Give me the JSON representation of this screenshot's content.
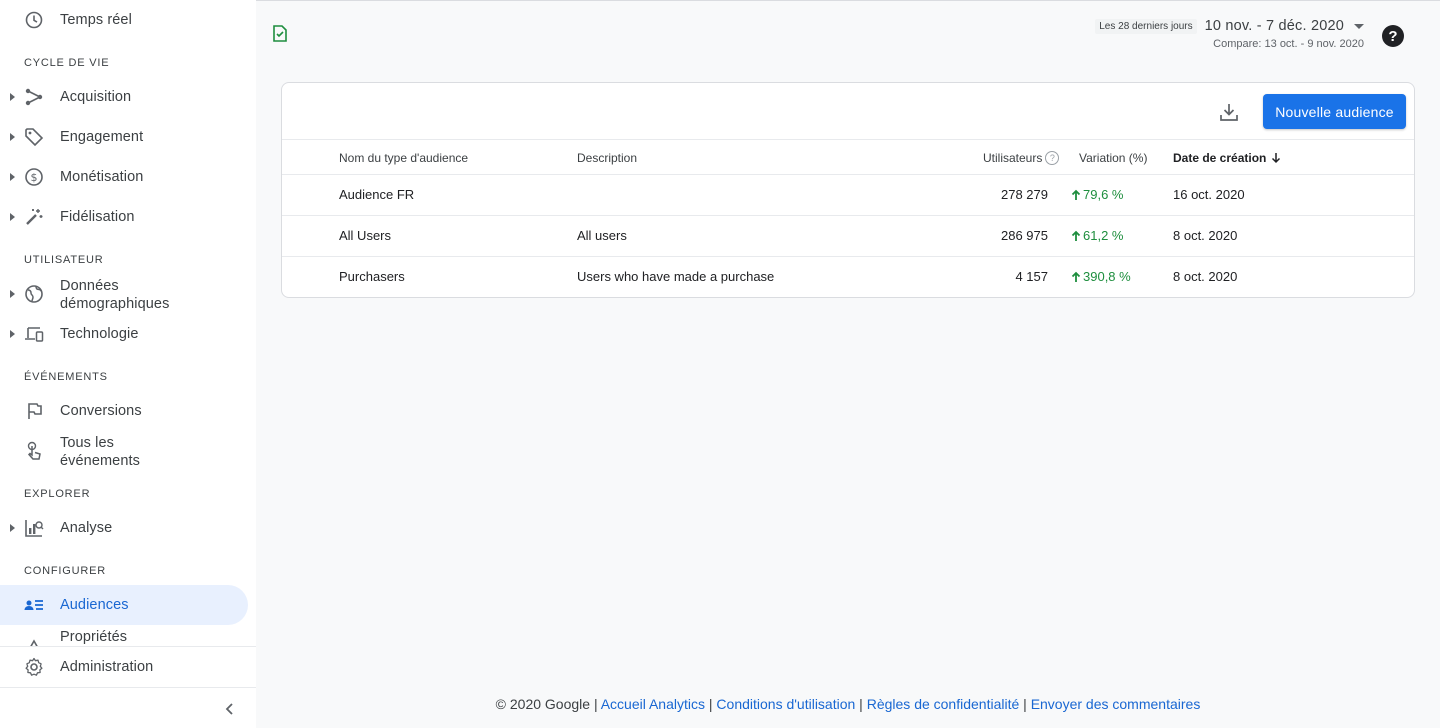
{
  "sidebar": {
    "realtime_label": "Temps réel",
    "sections": {
      "lifecycle": "CYCLE DE VIE",
      "user": "UTILISATEUR",
      "events": "ÉVÉNEMENTS",
      "explore": "EXPLORER",
      "configure": "CONFIGURER"
    },
    "items": {
      "acquisition": "Acquisition",
      "engagement": "Engagement",
      "monetization": "Monétisation",
      "retention": "Fidélisation",
      "demographics_1": "Données",
      "demographics_2": "démographiques",
      "technology": "Technologie",
      "conversions": "Conversions",
      "all_events_1": "Tous les",
      "all_events_2": "événements",
      "analysis": "Analyse",
      "audiences": "Audiences",
      "properties": "Propriétés",
      "admin": "Administration"
    }
  },
  "header": {
    "date_chip": "Les 28 derniers jours",
    "date_range": "10 nov. - 7 déc. 2020",
    "compare": "Compare: 13 oct. - 9 nov. 2020"
  },
  "toolbar": {
    "new_audience": "Nouvelle audience"
  },
  "table": {
    "columns": {
      "name": "Nom du type d'audience",
      "description": "Description",
      "users": "Utilisateurs",
      "variation": "Variation (%)",
      "created": "Date de création"
    },
    "rows": [
      {
        "name": "Audience FR",
        "description": "",
        "users": "278 279",
        "variation": "79,6 %",
        "created": "16 oct. 2020"
      },
      {
        "name": "All Users",
        "description": "All users",
        "users": "286 975",
        "variation": "61,2 %",
        "created": "8 oct. 2020"
      },
      {
        "name": "Purchasers",
        "description": "Users who have made a purchase",
        "users": "4 157",
        "variation": "390,8 %",
        "created": "8 oct. 2020"
      }
    ]
  },
  "footer": {
    "copyright": "© 2020 Google",
    "sep": " | ",
    "links": [
      "Accueil Analytics",
      "Conditions d'utilisation",
      "Règles de confidentialité",
      "Envoyer des commentaires"
    ]
  },
  "colors": {
    "primary": "#1a73e8",
    "active_bg": "#e8f0fe",
    "positive": "#1e8e3e"
  }
}
